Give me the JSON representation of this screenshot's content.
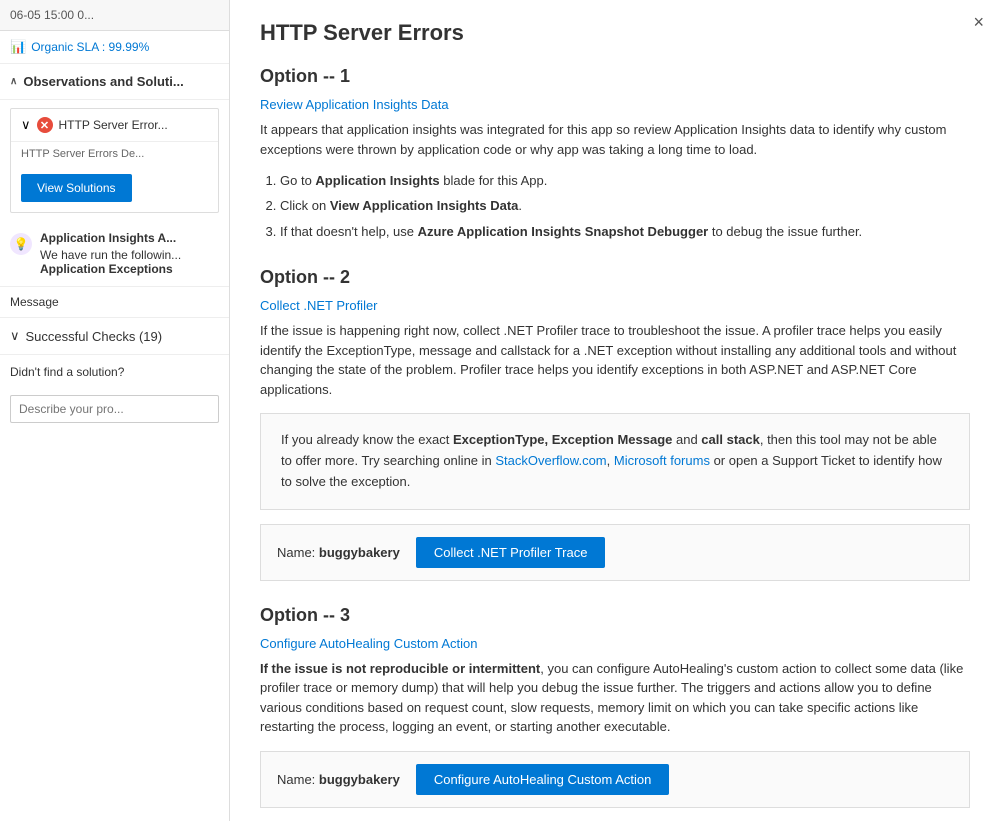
{
  "leftPanel": {
    "topBar": {
      "text": "06-05 15:00  0..."
    },
    "organicSla": {
      "label": "Organic SLA : 99.99%"
    },
    "observationsSection": {
      "label": "Observations and Soluti...",
      "chevron": "∧"
    },
    "httpErrorItem": {
      "title": "HTTP Server Error...",
      "description": "HTTP Server Errors De...",
      "viewSolutionsBtn": "View Solutions"
    },
    "appInsightsItem": {
      "title": "Application Insights A...",
      "desc1": "We have run the followin...",
      "desc2Bold": "Application Exceptions"
    },
    "messageRow": "Message",
    "successfulChecks": {
      "label": "Successful Checks (19)",
      "chevron": "∨"
    },
    "didntFind": "Didn't find a solution?",
    "describePlaceholder": "Describe your pro..."
  },
  "rightPanel": {
    "title": "HTTP Server Errors",
    "closeBtn": "×",
    "option1": {
      "heading": "Option -- 1",
      "subtitle": "Review Application Insights Data",
      "desc": "It appears that application insights was integrated for this app so review Application Insights data to identify why custom exceptions were thrown by application code or why app was taking a long time to load.",
      "steps": [
        {
          "text": "Go to ",
          "boldText": "Application Insights",
          "text2": " blade for this App."
        },
        {
          "text": "Click on ",
          "boldText": "View Application Insights Data",
          "text2": "."
        },
        {
          "text": "If that doesn't help, use ",
          "boldText": "Azure Application Insights Snapshot Debugger",
          "text2": " to debug the issue further."
        }
      ]
    },
    "option2": {
      "heading": "Option -- 2",
      "subtitle": "Collect .NET Profiler",
      "desc": "If the issue is happening right now, collect .NET Profiler trace to troubleshoot the issue. A profiler trace helps you easily identify the ExceptionType, message and callstack for a .NET exception without installing any additional tools and without changing the state of the problem. Profiler trace helps you identify exceptions in both ASP.NET and ASP.NET Core applications.",
      "infoBox": {
        "text1": "If you already know the exact ",
        "bold1": "ExceptionType, Exception Message",
        "text2": " and ",
        "bold2": "call stack",
        "text3": ", then this tool may not be able to offer more. Try searching online in ",
        "link1": "StackOverflow.com",
        "text4": ", ",
        "link2": "Microsoft forums",
        "text5": " or open a Support Ticket to identify how to solve the exception."
      },
      "actionRow": {
        "nameLabel": "Name:",
        "nameValue": "buggybakery",
        "btnLabel": "Collect .NET Profiler Trace"
      }
    },
    "option3": {
      "heading": "Option -- 3",
      "subtitle": "Configure AutoHealing Custom Action",
      "descBold": "If the issue is not reproducible or intermittent",
      "desc": ", you can configure AutoHealing's custom action to collect some data (like profiler trace or memory dump) that will help you debug the issue further. The triggers and actions allow you to define various conditions based on request count, slow requests, memory limit on which you can take specific actions like restarting the process, logging an event, or starting another executable.",
      "actionRow": {
        "nameLabel": "Name:",
        "nameValue": "buggybakery",
        "btnLabel": "Configure AutoHealing Custom Action"
      }
    }
  }
}
